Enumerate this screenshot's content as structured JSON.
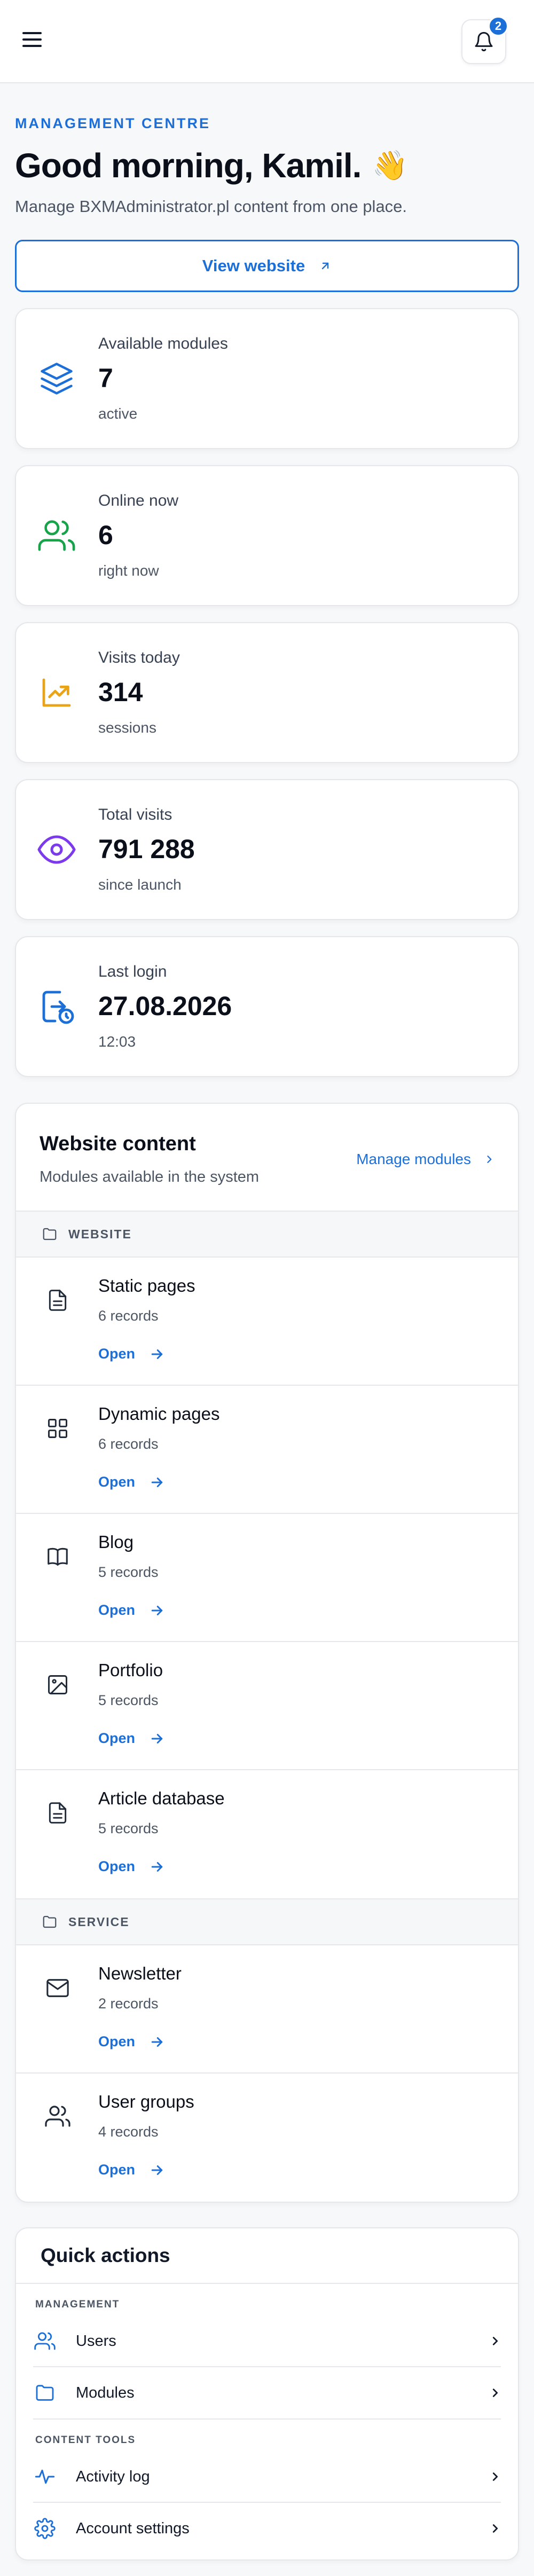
{
  "header": {
    "notification_count": "2"
  },
  "hero": {
    "eyebrow": "MANAGEMENT CENTRE",
    "greeting": "Good morning, Kamil.",
    "wave_emoji": "👋",
    "subtitle": "Manage BXMAdministrator.pl content from one place.",
    "view_website_label": "View website"
  },
  "stats": [
    {
      "label": "Available modules",
      "value": "7",
      "sub": "active",
      "icon": "layers-icon",
      "color": "#1d6fd8"
    },
    {
      "label": "Online now",
      "value": "6",
      "sub": "right now",
      "icon": "users-icon",
      "color": "#16a34a"
    },
    {
      "label": "Visits today",
      "value": "314",
      "sub": "sessions",
      "icon": "trend-up-icon",
      "color": "#e8a317"
    },
    {
      "label": "Total visits",
      "value": "791 288",
      "sub": "since launch",
      "icon": "eye-icon",
      "color": "#7c3aed"
    },
    {
      "label": "Last login",
      "value": "27.08.2026",
      "sub": "12:03",
      "icon": "login-clock-icon",
      "color": "#1d6fd8"
    }
  ],
  "content_panel": {
    "title": "Website content",
    "subtitle": "Modules available in the system",
    "manage_label": "Manage modules",
    "sections": [
      {
        "name": "WEBSITE",
        "modules": [
          {
            "name": "Static pages",
            "count": "6 records",
            "open": "Open",
            "icon": "file-text-icon"
          },
          {
            "name": "Dynamic pages",
            "count": "6 records",
            "open": "Open",
            "icon": "grid-icon"
          },
          {
            "name": "Blog",
            "count": "5 records",
            "open": "Open",
            "icon": "book-icon"
          },
          {
            "name": "Portfolio",
            "count": "5 records",
            "open": "Open",
            "icon": "image-icon"
          },
          {
            "name": "Article database",
            "count": "5 records",
            "open": "Open",
            "icon": "file-text-icon"
          }
        ]
      },
      {
        "name": "SERVICE",
        "modules": [
          {
            "name": "Newsletter",
            "count": "2 records",
            "open": "Open",
            "icon": "mail-icon"
          },
          {
            "name": "User groups",
            "count": "4 records",
            "open": "Open",
            "icon": "users-icon"
          }
        ]
      }
    ]
  },
  "quick_actions": {
    "title": "Quick actions",
    "groups": [
      {
        "name": "MANAGEMENT",
        "items": [
          {
            "label": "Users",
            "icon": "users-icon"
          },
          {
            "label": "Modules",
            "icon": "folder-icon"
          }
        ]
      },
      {
        "name": "CONTENT TOOLS",
        "items": [
          {
            "label": "Activity log",
            "icon": "activity-icon"
          },
          {
            "label": "Account settings",
            "icon": "gear-icon"
          }
        ]
      }
    ]
  }
}
